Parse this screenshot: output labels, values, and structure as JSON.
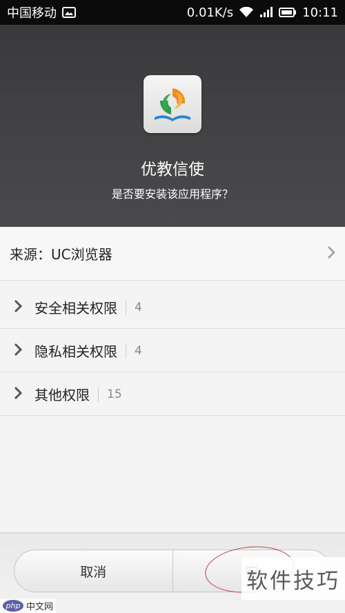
{
  "status_bar": {
    "carrier": "中国移动",
    "speed": "0.01K/s",
    "time": "10:11",
    "icons": [
      "image-icon",
      "wifi-icon",
      "signal-icon",
      "battery-icon"
    ]
  },
  "header": {
    "app_name": "优教信使",
    "question": "是否要安装该应用程序？"
  },
  "source": {
    "label": "来源：",
    "value": "UC浏览器"
  },
  "permissions": [
    {
      "label": "安全相关权限",
      "count": "4"
    },
    {
      "label": "隐私相关权限",
      "count": "4"
    },
    {
      "label": "其他权限",
      "count": "15"
    }
  ],
  "buttons": {
    "cancel": "取消",
    "install": "安"
  },
  "watermarks": {
    "right": "软件技巧",
    "left_logo": "php",
    "left_text": "中文网"
  },
  "colors": {
    "header_bg": "#3f3f41",
    "annotation": "#c0424a"
  }
}
